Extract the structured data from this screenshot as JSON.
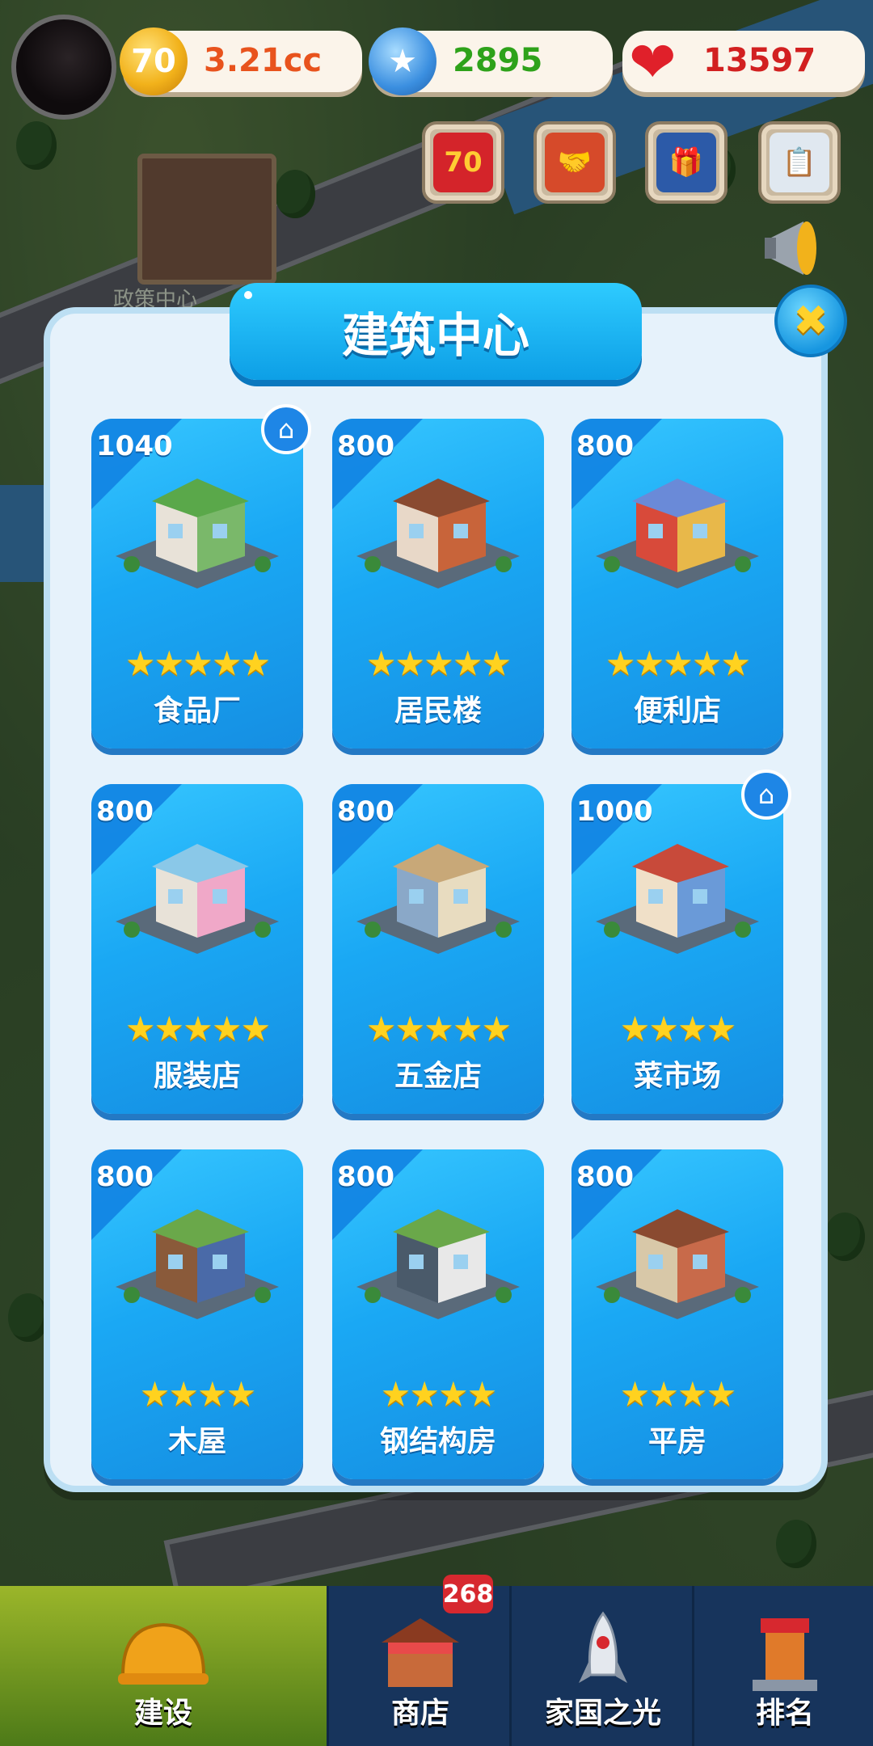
{
  "hud": {
    "coins": "3.21cc",
    "stars": "2895",
    "hearts": "13597",
    "coin_symbol": "70"
  },
  "background": {
    "building_label": "政策中心"
  },
  "modal": {
    "title": "建筑中心",
    "close_symbol": "✖",
    "cards": [
      {
        "price": "1040",
        "stars": 5,
        "name": "食品厂",
        "home": true
      },
      {
        "price": "800",
        "stars": 5,
        "name": "居民楼",
        "home": false
      },
      {
        "price": "800",
        "stars": 5,
        "name": "便利店",
        "home": false
      },
      {
        "price": "800",
        "stars": 5,
        "name": "服装店",
        "home": false
      },
      {
        "price": "800",
        "stars": 5,
        "name": "五金店",
        "home": false
      },
      {
        "price": "1000",
        "stars": 4,
        "name": "菜市场",
        "home": true
      },
      {
        "price": "800",
        "stars": 4,
        "name": "木屋",
        "home": false
      },
      {
        "price": "800",
        "stars": 4,
        "name": "钢结构房",
        "home": false
      },
      {
        "price": "800",
        "stars": 4,
        "name": "平房",
        "home": false
      }
    ]
  },
  "nav": {
    "badge": "268",
    "tabs": [
      {
        "label": "建设",
        "active": true
      },
      {
        "label": "商店",
        "active": false
      },
      {
        "label": "家国之光",
        "active": false
      },
      {
        "label": "排名",
        "active": false
      }
    ]
  },
  "colors": {
    "card_blue": "#1aa8f4",
    "title_blue": "#0d9fe6",
    "star_gold": "#ffd21f",
    "active_tab": "#9bb62a"
  }
}
